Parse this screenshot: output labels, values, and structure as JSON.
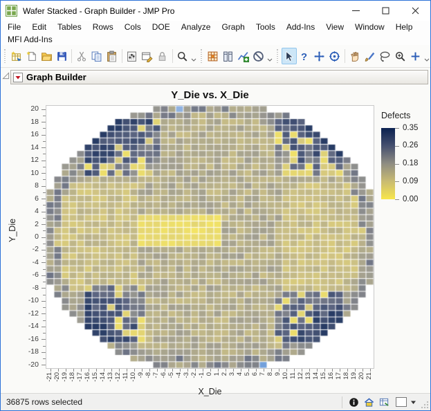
{
  "window": {
    "title": "Wafer Stacked - Graph Builder - JMP Pro"
  },
  "menu": {
    "items": [
      "File",
      "Edit",
      "Tables",
      "Rows",
      "Cols",
      "DOE",
      "Analyze",
      "Graph",
      "Tools",
      "Add-Ins",
      "View",
      "Window",
      "Help"
    ]
  },
  "menu_row2": {
    "items": [
      "MFI Add-Ins"
    ]
  },
  "toolbar": {
    "groups": [
      {
        "icons": [
          "new-data-table",
          "new-script",
          "open",
          "save",
          "|",
          "cut",
          "copy",
          "paste",
          "|",
          "preferences",
          "layout",
          "lock",
          "|",
          "search"
        ],
        "selected": ""
      },
      {
        "icons": [
          "data-table",
          "columns",
          "graph-add",
          "disable"
        ],
        "selected": ""
      },
      {
        "icons": [
          "arrow",
          "help",
          "move",
          "target",
          "|",
          "hand",
          "brush",
          "lasso",
          "zoom",
          "plus"
        ],
        "selected": "arrow"
      }
    ]
  },
  "report": {
    "header": "Graph Builder"
  },
  "status_bar": {
    "text": "36875 rows selected"
  },
  "chart_data": {
    "type": "heatmap",
    "title": "Y_Die vs. X_Die",
    "xlabel": "X_Die",
    "ylabel": "Y_Die",
    "x_range": [
      -21,
      21
    ],
    "y_range": [
      -20,
      20
    ],
    "x_tick_step": 1,
    "y_label_step": 2,
    "legend": {
      "title": "Defects",
      "tick_labels": [
        "0.35",
        "0.26",
        "0.18",
        "0.09",
        "0.00"
      ],
      "min": 0,
      "max": 0.35,
      "gradient": [
        [
          0,
          "#F8E64B"
        ],
        [
          0.25,
          "#C9BB72"
        ],
        [
          0.5,
          "#8F8D82"
        ],
        [
          0.75,
          "#46506F"
        ],
        [
          1,
          "#0A2150"
        ]
      ]
    },
    "wafer": {
      "ellipse_rx": 22.4,
      "ellipse_ry": 21.4,
      "edge_ring_threshold": 0.8,
      "seed": 7,
      "cell_alpha": 0.88
    },
    "regions": {
      "base": {
        "value": 0.1,
        "noise": 0.07
      },
      "side_lobes": {
        "min_abs_x": 10,
        "max_abs_y": 8,
        "value": 0.07,
        "noise": 0.06
      },
      "edge_ring": {
        "value": 0.13,
        "noise": 0.11
      },
      "center_low": {
        "x": [
          -9,
          1
        ],
        "y": [
          -1,
          3
        ],
        "value": 0.012,
        "noise": 0.035
      },
      "clusters": [
        {
          "x": [
            -16,
            -7
          ],
          "y": [
            10,
            18
          ],
          "ox": -16,
          "ix": -7,
          "oy": 18,
          "iy": 10
        },
        {
          "x": [
            9,
            17
          ],
          "y": [
            10,
            18
          ],
          "ox": 17,
          "ix": 9,
          "oy": 18,
          "iy": 10
        },
        {
          "x": [
            -16,
            -9
          ],
          "y": [
            -16,
            -8
          ],
          "ox": -16,
          "ix": -9,
          "oy": -16,
          "iy": -8
        },
        {
          "x": [
            9,
            17
          ],
          "y": [
            -16,
            -9
          ],
          "ox": 17,
          "ix": 9,
          "oy": -16,
          "iy": -9
        }
      ],
      "cluster_style": {
        "value": 0.13,
        "gradient": 0.2,
        "noise": 0.1,
        "speckle_chance": 0.25,
        "speckle_value": 0.02,
        "speckle_noise": 0.06
      }
    },
    "special_cells": [
      {
        "x": -4,
        "y": 20,
        "color": "#7FA7DC"
      },
      {
        "x": 7,
        "y": -20,
        "color": "#5E93D6"
      },
      {
        "x": -8,
        "y": 18,
        "value": 0.34
      },
      {
        "x": -15,
        "y": 13,
        "value": 0.34
      },
      {
        "x": 15,
        "y": 15,
        "value": 0.35
      },
      {
        "x": 12,
        "y": 12,
        "value": 0.31
      }
    ]
  }
}
